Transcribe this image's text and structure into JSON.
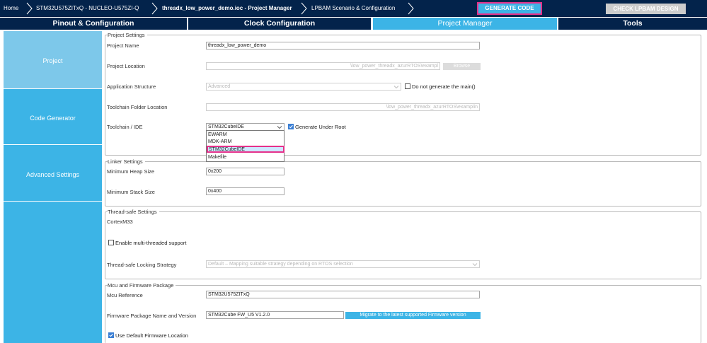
{
  "breadcrumb": {
    "home": "Home",
    "mcu": "STM32U575ZITxQ  -  NUCLEO-U575ZI-Q",
    "project": "threadx_low_power_demo.ioc - Project Manager",
    "lpbam": "LPBAM Scenario & Configuration"
  },
  "toolbar": {
    "generate_label": "GENERATE CODE",
    "lpbam_check_label": "CHECK LPBAM DESIGN"
  },
  "tabs": [
    {
      "label": "Pinout & Configuration"
    },
    {
      "label": "Clock Configuration"
    },
    {
      "label": "Project Manager"
    },
    {
      "label": "Tools"
    }
  ],
  "sidebar": {
    "items": [
      {
        "label": "Project"
      },
      {
        "label": "Code Generator"
      },
      {
        "label": "Advanced Settings"
      }
    ]
  },
  "project_settings": {
    "title": "Project Settings",
    "name_label": "Project Name",
    "name_value": "threadx_low_power_demo",
    "location_label": "Project Location",
    "location_value": "\\low_power_threadx_azurRTOS\\exampl",
    "browse_label": "Browse",
    "app_structure_label": "Application Structure",
    "app_structure_value": "Advanced",
    "no_main_label": "Do not generate the main()",
    "toolchain_folder_label": "Toolchain Folder Location",
    "toolchain_folder_value": "\\low_power_threadx_azurRTOS\\examplin",
    "toolchain_label": "Toolchain / IDE",
    "toolchain_value": "STM32CubeIDE",
    "generate_root_label": "Generate Under Root",
    "toolchain_options": [
      "EWARM",
      "MDK-ARM",
      "STM32CubeIDE",
      "Makefile"
    ]
  },
  "linker_settings": {
    "title": "Linker Settings",
    "heap_label": "Minimum Heap Size",
    "heap_value": "0x200",
    "stack_label": "Minimum Stack Size",
    "stack_value": "0x400"
  },
  "thread_safe": {
    "title": "Thread-safe Settings",
    "core": "CortexM33",
    "multi_thread_label": "Enable multi-threaded support",
    "strategy_label": "Thread-safe Locking Strategy",
    "strategy_value": "Default – Mapping suitable strategy depending on RTOS selection"
  },
  "mcu_firmware": {
    "title": "Mcu and Firmware Package",
    "mcu_ref_label": "Mcu Reference",
    "mcu_ref_value": "STM32U575ZITxQ",
    "fw_label": "Firmware Package Name and Version",
    "fw_value": "STM32Cube FW_U5 V1.2.0",
    "migrate_label": "Migrate to the latest supported Firmware version",
    "default_location_label": "Use Default Firmware Location"
  },
  "colors": {
    "navy": "#03234b",
    "accent_blue": "#3cb4e6",
    "highlight_pink": "#e5308a"
  }
}
